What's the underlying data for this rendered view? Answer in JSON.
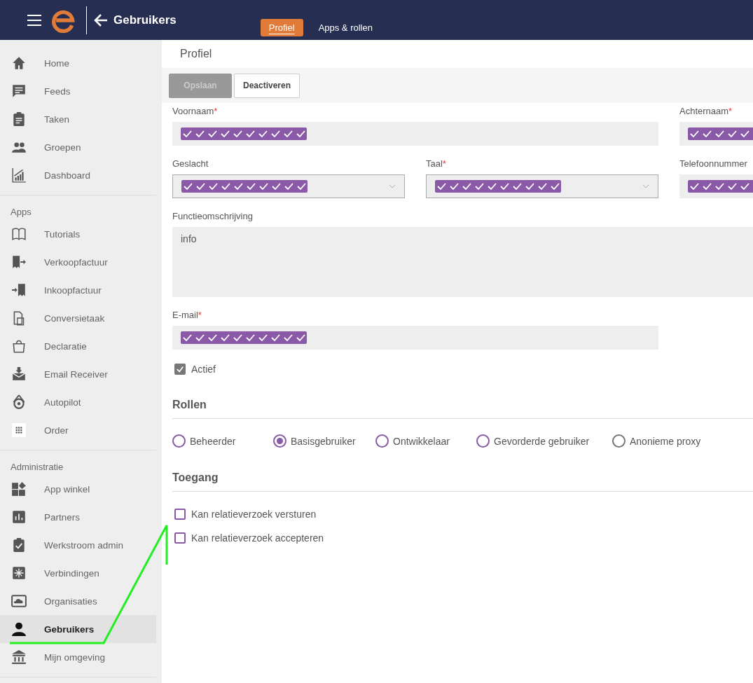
{
  "topbar": {
    "title": "Gebruikers",
    "tabs": [
      {
        "label": "Profiel",
        "selected": true
      },
      {
        "label": "Apps & rollen",
        "selected": false
      }
    ]
  },
  "sidebar": {
    "sections": [
      {
        "items": [
          {
            "label": "Home",
            "selected": false
          },
          {
            "label": "Feeds",
            "selected": false
          },
          {
            "label": "Taken",
            "selected": false
          },
          {
            "label": "Groepen",
            "selected": false
          },
          {
            "label": "Dashboard",
            "selected": false
          }
        ]
      },
      {
        "heading": "Apps",
        "items": [
          {
            "label": "Tutorials",
            "selected": false
          },
          {
            "label": "Verkoopfactuur",
            "selected": false
          },
          {
            "label": "Inkoopfactuur",
            "selected": false
          },
          {
            "label": "Conversietaak",
            "selected": false
          },
          {
            "label": "Declaratie",
            "selected": false
          },
          {
            "label": "Email Receiver",
            "selected": false
          },
          {
            "label": "Autopilot",
            "selected": false
          },
          {
            "label": "Order",
            "selected": false
          }
        ]
      },
      {
        "heading": "Administratie",
        "items": [
          {
            "label": "App winkel",
            "selected": false
          },
          {
            "label": "Partners",
            "selected": false
          },
          {
            "label": "Werkstroom admin",
            "selected": false
          },
          {
            "label": "Verbindingen",
            "selected": false
          },
          {
            "label": "Organisaties",
            "selected": false
          },
          {
            "label": "Gebruikers",
            "selected": true
          },
          {
            "label": "Mijn omgeving",
            "selected": false
          }
        ]
      }
    ]
  },
  "page": {
    "title": "Profiel",
    "buttons": [
      {
        "label": "Opslaan",
        "disabled": true
      },
      {
        "label": "Deactiveren",
        "disabled": false
      }
    ]
  },
  "form": {
    "first_name": {
      "label": "Voornaam",
      "required_mark": "*",
      "kind": "text",
      "masked": true
    },
    "last_name": {
      "label": "Achternaam",
      "required_mark": "*",
      "kind": "text",
      "masked": true
    },
    "gender": {
      "label": "Geslacht",
      "kind": "select",
      "masked": true
    },
    "language": {
      "label": "Taal",
      "required_mark": "*",
      "kind": "select",
      "masked": true
    },
    "phone": {
      "label": "Telefoonnummer",
      "kind": "text",
      "masked": true
    },
    "job_description": {
      "label": "Functieomschrijving",
      "kind": "textarea",
      "masked": false,
      "value": "info"
    },
    "email": {
      "label": "E-mail",
      "required_mark": "*",
      "kind": "text",
      "masked": true
    },
    "active": {
      "label": "Actief",
      "checked": true
    }
  },
  "roles": {
    "title": "Rollen",
    "options": [
      {
        "label": "Beheerder",
        "selected": false,
        "disabled": false
      },
      {
        "label": "Basisgebruiker",
        "selected": true,
        "disabled": false
      },
      {
        "label": "Ontwikkelaar",
        "selected": false,
        "disabled": false
      },
      {
        "label": "Gevorderde gebruiker",
        "selected": false,
        "disabled": false
      },
      {
        "label": "Anonieme proxy",
        "selected": false,
        "disabled": true
      }
    ]
  },
  "access": {
    "title": "Toegang",
    "options": [
      {
        "label": "Kan relatieverzoek versturen",
        "checked": false
      },
      {
        "label": "Kan relatieverzoek accepteren",
        "checked": false
      }
    ]
  }
}
